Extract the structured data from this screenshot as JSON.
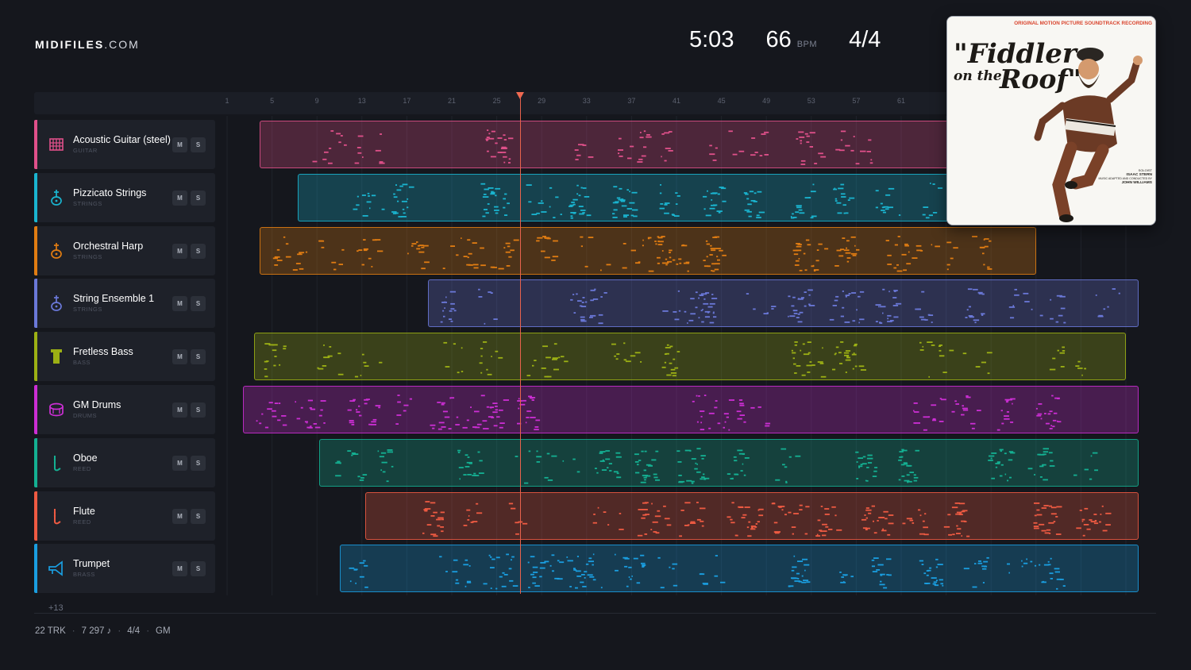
{
  "brand": {
    "bold": "MIDIFILES",
    "light": ".COM"
  },
  "header": {
    "duration": "5:03",
    "bpm": "66",
    "bpm_unit": "BPM",
    "time_signature": "4/4"
  },
  "album": {
    "top_line": "ORIGINAL MOTION PICTURE SOUNDTRACK RECORDING",
    "title_line1": "\"Fiddler",
    "title_line2": "on the",
    "title_line3": "Roof\"",
    "credit_1": "SOLOIST",
    "credit_2": "ISAAC STERN",
    "credit_3": "MUSIC ADAPTED AND CONDUCTED BY",
    "credit_4": "JOHN WILLIAMS"
  },
  "ruler": {
    "bars": [
      "1",
      "5",
      "9",
      "13",
      "17",
      "21",
      "25",
      "29",
      "33",
      "37",
      "41",
      "45",
      "49",
      "53",
      "57",
      "61"
    ]
  },
  "tracks": [
    {
      "name": "Acoustic Guitar (steel)",
      "category": "GUITAR",
      "icon": "guitar-icon",
      "color": "#e0508a",
      "start": 0.03,
      "end": 1.0
    },
    {
      "name": "Pizzicato Strings",
      "category": "STRINGS",
      "icon": "violin-icon",
      "color": "#1ab4cf",
      "start": 0.072,
      "end": 1.0
    },
    {
      "name": "Orchestral Harp",
      "category": "STRINGS",
      "icon": "violin-icon",
      "color": "#e07c12",
      "start": 0.03,
      "end": 0.878
    },
    {
      "name": "String Ensemble 1",
      "category": "STRINGS",
      "icon": "violin-icon",
      "color": "#6a78d8",
      "start": 0.214,
      "end": 0.99
    },
    {
      "name": "Fretless Bass",
      "category": "BASS",
      "icon": "bass-icon",
      "color": "#9cb014",
      "start": 0.024,
      "end": 0.976
    },
    {
      "name": "GM Drums",
      "category": "DRUMS",
      "icon": "drum-icon",
      "color": "#cc2ed4",
      "start": 0.012,
      "end": 0.99
    },
    {
      "name": "Oboe",
      "category": "REED",
      "icon": "reed-icon",
      "color": "#14b092",
      "start": 0.095,
      "end": 0.99
    },
    {
      "name": "Flute",
      "category": "REED",
      "icon": "reed-icon",
      "color": "#ee5a42",
      "start": 0.146,
      "end": 0.99
    },
    {
      "name": "Trumpet",
      "category": "BRASS",
      "icon": "trumpet-icon",
      "color": "#1a9ee0",
      "start": 0.118,
      "end": 0.99
    }
  ],
  "buttons": {
    "mute": "M",
    "solo": "S"
  },
  "more_tracks": "+13",
  "footer": {
    "tracks": "22 TRK",
    "notes": "7 297 ♪",
    "time_signature": "4/4",
    "standard": "GM",
    "separator": "·"
  },
  "playhead_bar": 26
}
